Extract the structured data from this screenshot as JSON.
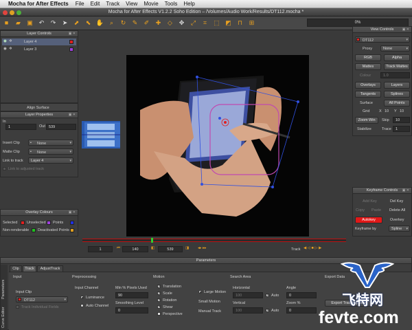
{
  "menubar": {
    "app": "Mocha for After Effects",
    "items": [
      "File",
      "Edit",
      "Track",
      "View",
      "Movie",
      "Tools",
      "Help"
    ]
  },
  "window": {
    "title": "Mocha for After Effects V1.2.2 Soho Edition – /Volumes/Audio Work/Results/DT112.mocha *"
  },
  "toolbar": {
    "progress": "0%"
  },
  "layer_controls": {
    "title": "Layer Controls",
    "layers": [
      {
        "name": "Layer 4",
        "color": "#e02020"
      },
      {
        "name": "Layer 3",
        "color": "#a040e0"
      }
    ],
    "align_button": "Align Surface"
  },
  "layer_properties": {
    "title": "Layer Properties",
    "in_label": "In",
    "in_value": "1",
    "out_label": "Out",
    "out_value": "539",
    "insert_clip_label": "Insert Clip",
    "insert_clip_value": "None",
    "matte_clip_label": "Matte Clip",
    "matte_clip_value": "None",
    "link_track_label": "Link to track",
    "link_track_value": "Layer 4",
    "adjusted_track_label": "Link to adjusted track"
  },
  "overlay_colours": {
    "title": "Overlay Colours",
    "items": [
      {
        "label": "Selected",
        "color": "#e02020"
      },
      {
        "label": "Unselected",
        "color": "#a040e0"
      },
      {
        "label": "Points",
        "color": "#2030e0"
      },
      {
        "label": "Non-renderable",
        "color": "#20c020"
      },
      {
        "label": "Deactivated Points",
        "color": "#e0a020"
      }
    ]
  },
  "view_controls": {
    "title": "View Controls",
    "clip_value": "DT112",
    "proxy_label": "Proxy",
    "proxy_value": "None",
    "rgb": "RGB",
    "alpha": "Alpha",
    "mattes": "Mattes",
    "track_mattes": "Track Mattes",
    "colour_label": "Colour",
    "colour_value": "1.0",
    "overlays": "Overlays",
    "layers": "Layers",
    "tangents": "Tangents",
    "splines": "Splines",
    "surface": "Surface",
    "all_points": "All Points",
    "grid_label": "Grid",
    "grid_x": "X",
    "grid_x_value": "10",
    "grid_y": "Y",
    "grid_y_value": "10",
    "zoom_win_label": "Zoom Win",
    "skip_label": "Skip",
    "skip_value": "10",
    "stabilize_label": "Stabilize",
    "trace_label": "Trace",
    "trace_value": "1"
  },
  "keyframe_controls": {
    "title": "Keyframe Controls",
    "add_key": "Add Key",
    "del_key": "Del Key",
    "copy": "Copy",
    "paste": "Paste",
    "delete_all": "Delete All",
    "autokey": "Autokey",
    "overkey": "Overkey",
    "keyframe_by_label": "Keyframe by",
    "keyframe_by_value": "Spline"
  },
  "timeline": {
    "start_value": "1",
    "current_value": "140",
    "end_value": "539",
    "track_label": "Track",
    "playhead_fraction": 0.26
  },
  "parameters": {
    "title": "Parameters",
    "side_tabs": [
      "Parameters",
      "Curve Editor"
    ],
    "tabs": [
      "Clip",
      "Track",
      "AdjustTrack"
    ],
    "active_tab": "Track",
    "input": {
      "title": "Input",
      "clip_label": "Input Clip",
      "clip_value": "DT112",
      "track_fields_label": "Track Individual Fields"
    },
    "preprocessing": {
      "title": "Preprocessing",
      "channel_label": "Input Channel",
      "luminance": "Luminance",
      "auto_channel": "Auto Channel",
      "min_pixels_label": "Min % Pixels Used",
      "min_pixels_value": "90",
      "smoothing_label": "Smoothing Level",
      "smoothing_value": "0"
    },
    "motion": {
      "title": "Motion",
      "items": [
        "Translation",
        "Scale",
        "Rotation",
        "Shear",
        "Perspective"
      ],
      "large_motion": "Large Motion",
      "small_motion": "Small Motion",
      "manual_track": "Manual Track"
    },
    "search_area": {
      "title": "Search Area",
      "horizontal_label": "Horizontal",
      "horizontal_value": "100",
      "auto_h": "Auto",
      "vertical_label": "Vertical",
      "vertical_value": "100",
      "auto_v": "Auto",
      "angle_label": "Angle",
      "angle_value": "0",
      "zoom_label": "Zoom %",
      "zoom_value": "0"
    },
    "export": {
      "title": "Export Data",
      "button": "Export Tracking Data"
    }
  },
  "watermark": {
    "top": "飞特网",
    "bottom": "fevte.com"
  }
}
